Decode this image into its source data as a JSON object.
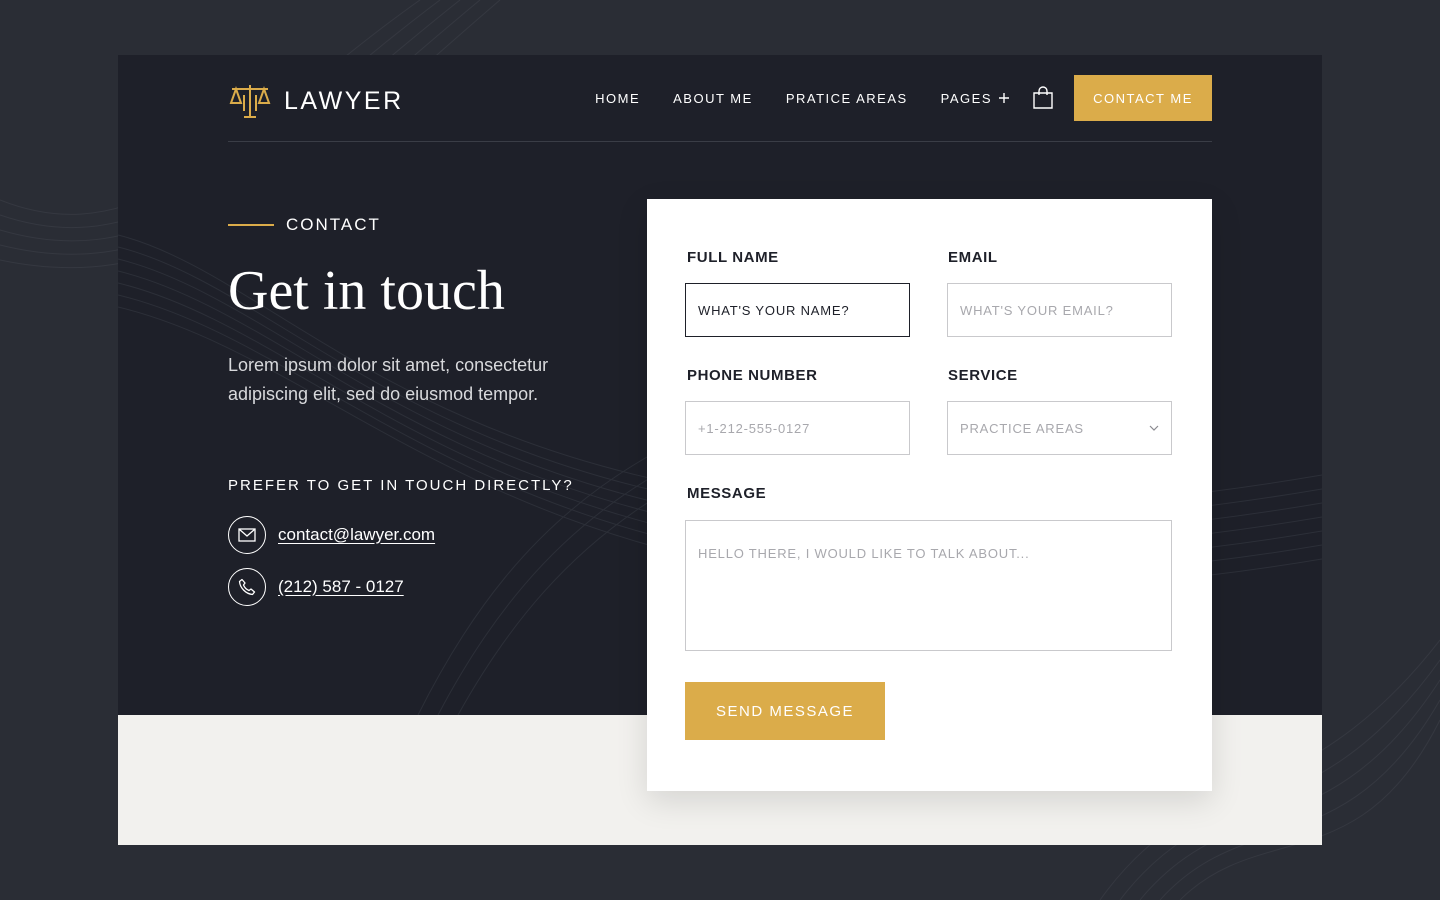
{
  "brand": {
    "name": "LAWYER",
    "logo_icon": "scales-of-justice-icon",
    "accent_color": "#dbac4a"
  },
  "nav": {
    "items": [
      {
        "label": "HOME"
      },
      {
        "label": "ABOUT ME"
      },
      {
        "label": "PRATICE AREAS"
      },
      {
        "label": "PAGES"
      }
    ],
    "pages_expand_icon": "plus-icon",
    "cart_icon": "shopping-bag-icon",
    "cta_label": "CONTACT ME"
  },
  "hero": {
    "eyebrow": "CONTACT",
    "title": "Get in touch",
    "lead": "Lorem ipsum dolor sit amet, consectetur adipiscing elit, sed do eiusmod tempor.",
    "direct_heading": "PREFER TO GET IN TOUCH DIRECTLY?",
    "email": "contact@lawyer.com",
    "phone": "(212) 587 - 0127"
  },
  "form": {
    "full_name": {
      "label": "FULL NAME",
      "placeholder": "WHAT'S YOUR NAME?"
    },
    "email": {
      "label": "EMAIL",
      "placeholder": "WHAT'S YOUR EMAIL?"
    },
    "phone": {
      "label": "PHONE NUMBER",
      "placeholder": "+1-212-555-0127"
    },
    "service": {
      "label": "SERVICE",
      "selected": "PRACTICE AREAS"
    },
    "message": {
      "label": "MESSAGE",
      "placeholder": "HELLO THERE, I WOULD LIKE TO TALK ABOUT..."
    },
    "submit_label": "SEND MESSAGE"
  }
}
